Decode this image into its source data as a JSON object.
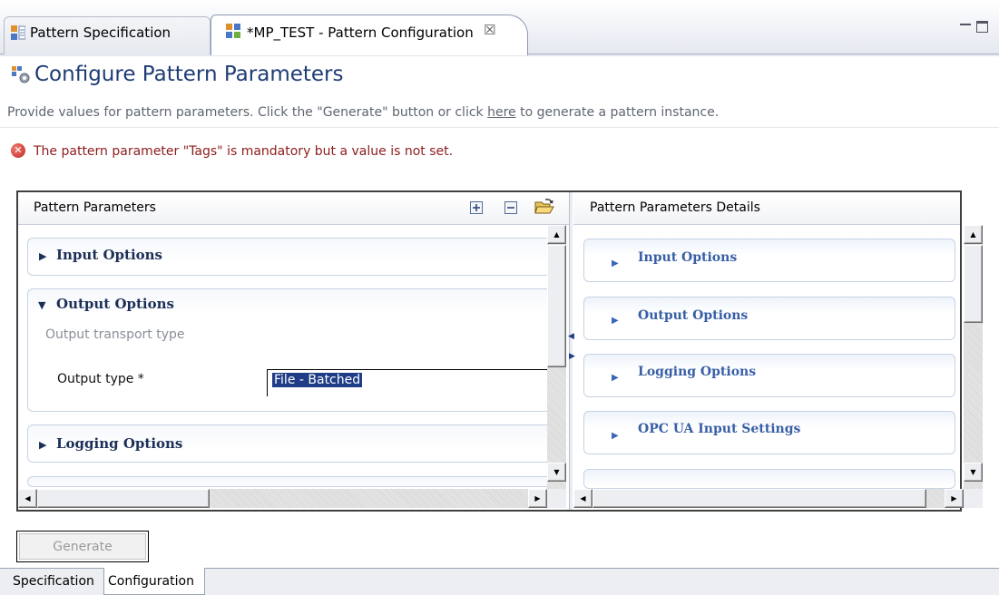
{
  "editor_tabs": [
    {
      "label": "Pattern Specification",
      "active": false,
      "icon": "pattern-spec-icon"
    },
    {
      "label": "*MP_TEST - Pattern Configuration",
      "active": true,
      "icon": "pattern-config-icon",
      "close": "☒"
    }
  ],
  "page": {
    "title": "Configure Pattern Parameters",
    "description_prefix": "Provide values for pattern parameters. Click the \"Generate\" button or click ",
    "description_link": "here",
    "description_suffix": " to generate a pattern instance.",
    "error_icon_glyph": "✕",
    "error_message": "The pattern parameter \"Tags\" is mandatory but a value is not set."
  },
  "left_pane": {
    "title": "Pattern Parameters",
    "toolbar_icons": [
      "expand-all-icon",
      "collapse-all-icon",
      "open-folder-icon"
    ],
    "sections": [
      {
        "title": "Input Options",
        "expanded": false
      },
      {
        "title": "Output Options",
        "expanded": true,
        "description": "Output transport type",
        "field_label": "Output type *",
        "field_value": "File - Batched"
      },
      {
        "title": "Logging Options",
        "expanded": false
      }
    ]
  },
  "right_pane": {
    "title": "Pattern Parameters Details",
    "sections": [
      {
        "title": "Input Options"
      },
      {
        "title": "Output Options"
      },
      {
        "title": "Logging Options"
      },
      {
        "title": "OPC UA Input Settings"
      }
    ]
  },
  "scroll_glyphs": {
    "up": "▲",
    "down": "▼",
    "left": "◀",
    "right": "▶"
  },
  "generate_button": {
    "label": "Generate",
    "enabled": false
  },
  "bottom_tabs": [
    {
      "label": "Specification",
      "active": false
    },
    {
      "label": "Configuration",
      "active": true
    }
  ],
  "colors": {
    "title_blue": "#1f3c74",
    "error_red": "#8d1c1c",
    "selection_blue": "#1f3d87",
    "detail_link_blue": "#385fa6"
  }
}
